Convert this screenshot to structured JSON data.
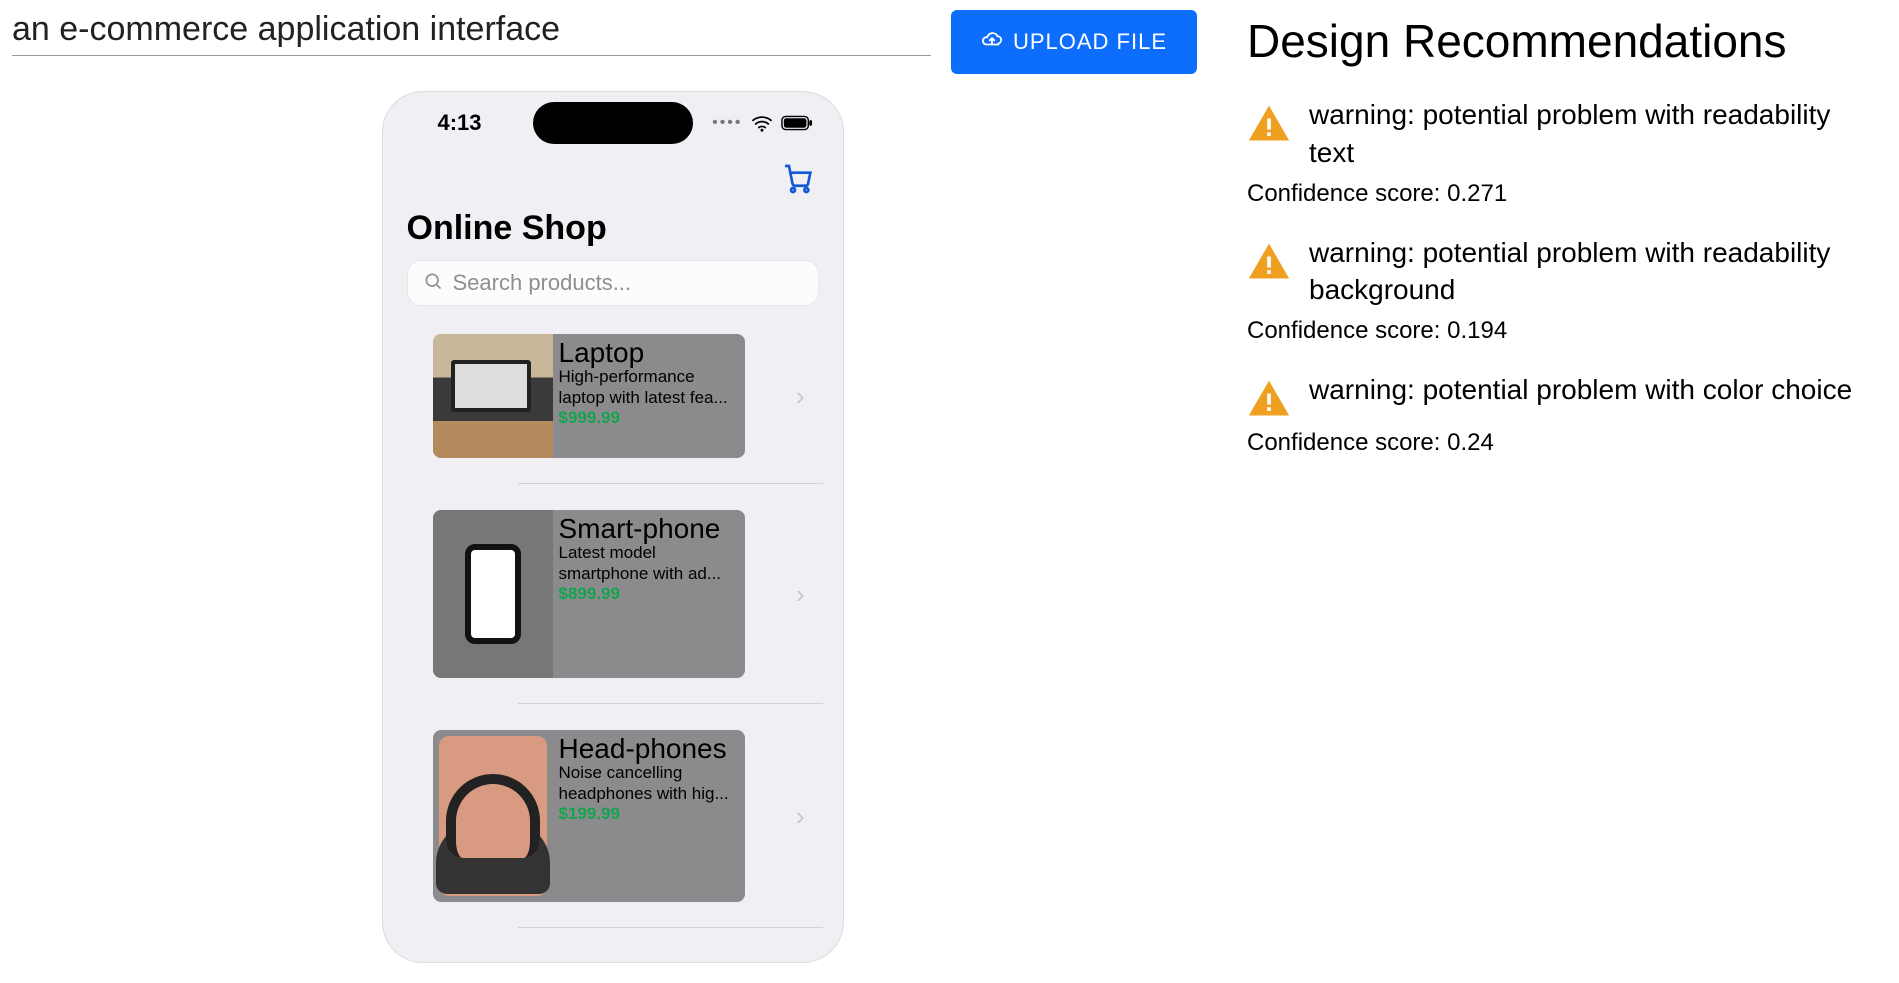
{
  "prompt": {
    "value": "an e-commerce application interface"
  },
  "upload": {
    "label": "UPLOAD FILE"
  },
  "phone": {
    "time": "4:13",
    "title": "Online Shop",
    "search_placeholder": "Search products...",
    "products": [
      {
        "name": "Laptop",
        "desc": "High-performance laptop with latest fea...",
        "price": "$999.99"
      },
      {
        "name": "Smart-phone",
        "desc": "Latest model smartphone with ad...",
        "price": "$899.99"
      },
      {
        "name": "Head-phones",
        "desc": "Noise cancelling headphones with hig...",
        "price": "$199.99"
      }
    ]
  },
  "recommendations": {
    "title": "Design Recommendations",
    "score_label_prefix": "Confidence score: ",
    "items": [
      {
        "text": "warning: potential problem with readability text",
        "score": "0.271"
      },
      {
        "text": "warning: potential problem with readability background",
        "score": "0.194"
      },
      {
        "text": "warning: potential problem with color choice",
        "score": "0.24"
      }
    ]
  }
}
